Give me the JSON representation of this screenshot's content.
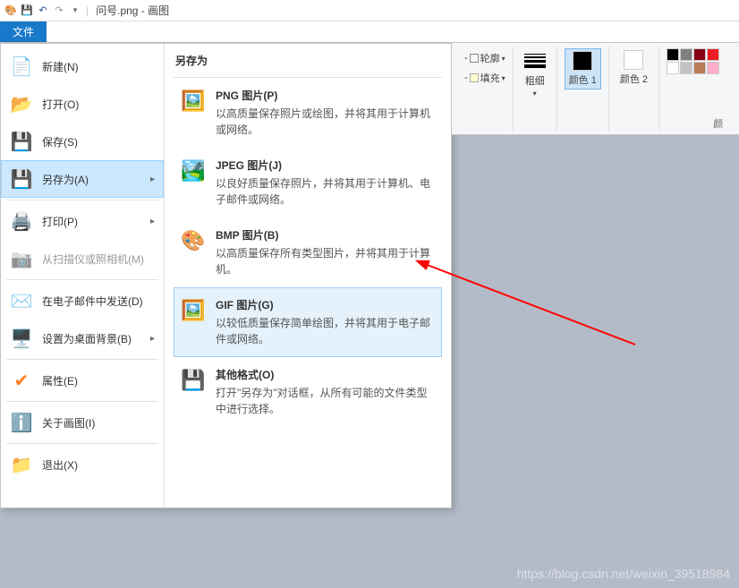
{
  "window": {
    "document_name": "问号.png",
    "app_name": "画图"
  },
  "tabs": {
    "file": "文件"
  },
  "file_menu": {
    "new": "新建(N)",
    "open": "打开(O)",
    "save": "保存(S)",
    "saveas": "另存为(A)",
    "print": "打印(P)",
    "scanner": "从扫描仪或照相机(M)",
    "email": "在电子邮件中发送(D)",
    "desktop": "设置为桌面背景(B)",
    "properties": "属性(E)",
    "about": "关于画图(I)",
    "exit": "退出(X)"
  },
  "saveas_panel": {
    "header": "另存为",
    "png": {
      "title": "PNG 图片(P)",
      "desc": "以高质量保存照片或绘图，并将其用于计算机或网络。"
    },
    "jpeg": {
      "title": "JPEG 图片(J)",
      "desc": "以良好质量保存照片，并将其用于计算机、电子邮件或网络。"
    },
    "bmp": {
      "title": "BMP 图片(B)",
      "desc": "以高质量保存所有类型图片，并将其用于计算机。"
    },
    "gif": {
      "title": "GIF 图片(G)",
      "desc": "以较低质量保存简单绘图，并将其用于电子邮件或网络。"
    },
    "other": {
      "title": "其他格式(O)",
      "desc": "打开\"另存为\"对话框，从所有可能的文件类型中进行选择。"
    }
  },
  "ribbon": {
    "outline": "轮廓",
    "fill": "填充",
    "thickness": "粗细",
    "color1": "颜色 1",
    "color2": "颜色 2",
    "colors_label": "颜"
  },
  "palette_colors": [
    "#000000",
    "#7f7f7f",
    "#880015",
    "#ed1c24",
    "#ff7f27",
    "#fff200",
    "#ffffff",
    "#c3c3c3"
  ],
  "watermark": "https://blog.csdn.net/weixin_39518984"
}
